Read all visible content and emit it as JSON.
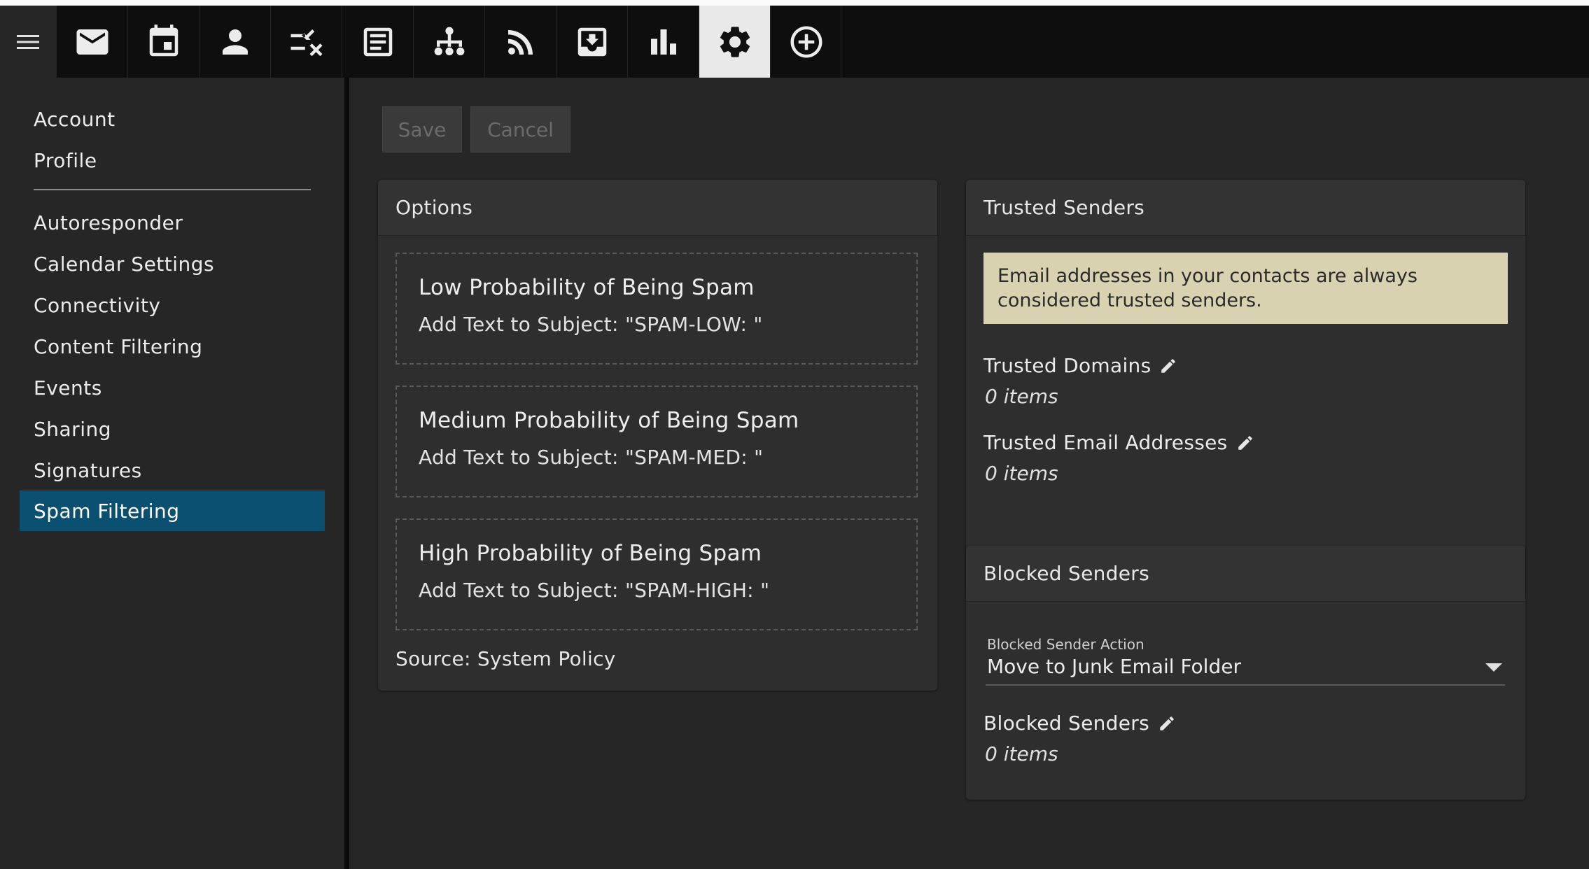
{
  "topbar": {
    "menu_icon": "hamburger-menu-icon",
    "buttons": [
      {
        "icon": "mail-icon"
      },
      {
        "icon": "calendar-icon"
      },
      {
        "icon": "contacts-icon"
      },
      {
        "icon": "tasks-icon"
      },
      {
        "icon": "notes-icon"
      },
      {
        "icon": "sitemap-icon"
      },
      {
        "icon": "rss-icon"
      },
      {
        "icon": "archive-download-icon"
      },
      {
        "icon": "reports-chart-icon"
      },
      {
        "icon": "settings-gear-icon",
        "active": true
      },
      {
        "icon": "add-circle-icon"
      }
    ]
  },
  "sidebar": {
    "top_items": [
      "Account",
      "Profile"
    ],
    "items": [
      "Autoresponder",
      "Calendar Settings",
      "Connectivity",
      "Content Filtering",
      "Events",
      "Sharing",
      "Signatures",
      "Spam Filtering"
    ],
    "active": "Spam Filtering"
  },
  "toolbar": {
    "save_label": "Save",
    "cancel_label": "Cancel"
  },
  "options": {
    "title": "Options",
    "levels": [
      {
        "title": "Low Probability of Being Spam",
        "subject": "Add Text to Subject: \"SPAM-LOW: \""
      },
      {
        "title": "Medium Probability of Being Spam",
        "subject": "Add Text to Subject: \"SPAM-MED: \""
      },
      {
        "title": "High Probability of Being Spam",
        "subject": "Add Text to Subject: \"SPAM-HIGH: \""
      }
    ],
    "source": "Source: System Policy"
  },
  "trusted": {
    "title": "Trusted Senders",
    "note": "Email addresses in your contacts are always considered trusted senders.",
    "domains_label": "Trusted Domains",
    "domains_count": "0 items",
    "emails_label": "Trusted Email Addresses",
    "emails_count": "0 items"
  },
  "blocked": {
    "title": "Blocked Senders",
    "action_caption": "Blocked Sender Action",
    "action_value": "Move to Junk Email Folder",
    "list_label": "Blocked Senders",
    "list_count": "0 items"
  },
  "colors": {
    "accent": "#0b4f71",
    "note_bg": "#d9d2b1",
    "active_tab": "#e9e9e9"
  }
}
